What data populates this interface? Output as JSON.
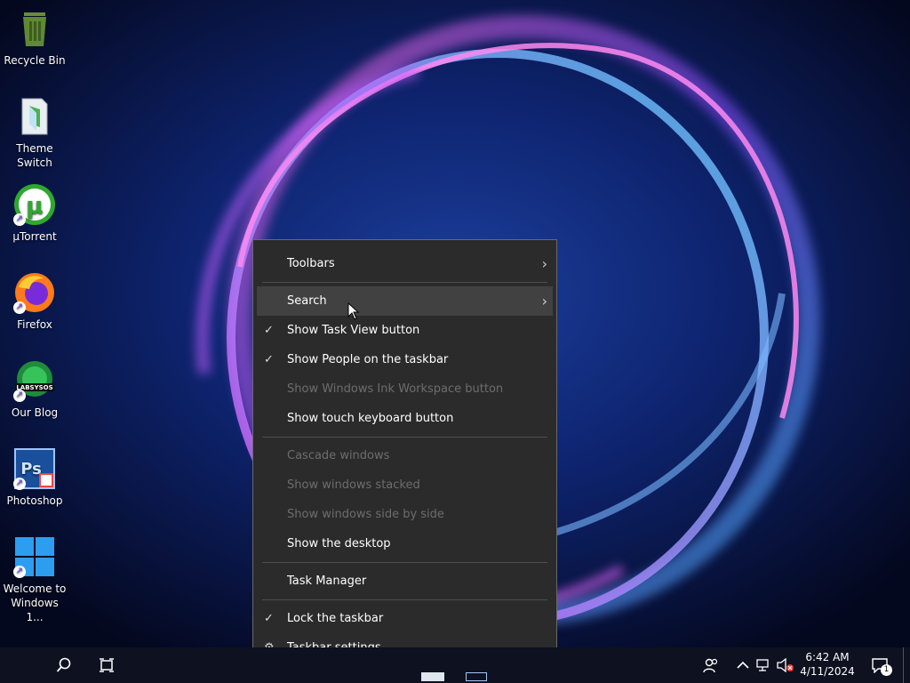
{
  "desktop": {
    "icons": [
      {
        "label": "Recycle Bin"
      },
      {
        "label": "Theme Switch"
      },
      {
        "label": "µTorrent"
      },
      {
        "label": "Firefox"
      },
      {
        "label": "Our Blog",
        "logo_text": "LABSYSOS"
      },
      {
        "label": "Photoshop",
        "logo_text": "Ps"
      },
      {
        "label": "Welcome to Windows 1..."
      }
    ]
  },
  "context_menu": {
    "items": [
      {
        "label": "Toolbars",
        "submenu": true
      },
      {
        "label": "Search",
        "submenu": true,
        "hovered": true
      },
      {
        "label": "Show Task View button",
        "checked": true
      },
      {
        "label": "Show People on the taskbar",
        "checked": true
      },
      {
        "label": "Show Windows Ink Workspace button",
        "disabled": true
      },
      {
        "label": "Show touch keyboard button"
      },
      {
        "label": "Cascade windows",
        "disabled": true
      },
      {
        "label": "Show windows stacked",
        "disabled": true
      },
      {
        "label": "Show windows side by side",
        "disabled": true
      },
      {
        "label": "Show the desktop"
      },
      {
        "label": "Task Manager"
      },
      {
        "label": "Lock the taskbar",
        "checked": true
      },
      {
        "label": "Taskbar settings",
        "icon": "gear-icon"
      }
    ]
  },
  "taskbar": {
    "clock_time": "6:42 AM",
    "clock_date": "4/11/2024",
    "notification_count": "1"
  },
  "colors": {
    "menu_bg": "#2b2b2b",
    "menu_hover": "#414141",
    "taskbar_bg": "#0d1120",
    "disabled_text": "#6d6d6d"
  }
}
